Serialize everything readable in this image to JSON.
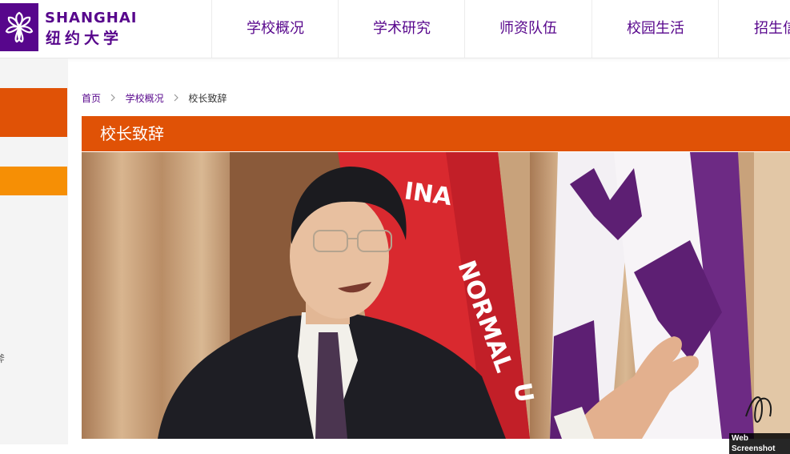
{
  "header": {
    "logo_en": "SHANGHAI",
    "logo_cn": "纽约大学",
    "nav": [
      "学校概况",
      "学术研究",
      "师资队伍",
      "校园生活",
      "招生信息"
    ]
  },
  "breadcrumb": {
    "home": "首页",
    "section": "学校概况",
    "current": "校长致辞"
  },
  "page": {
    "title": "校长致辞"
  },
  "sidebar": {
    "partial_text": "斧"
  },
  "photo": {
    "flag_letters": "INA NORMAL U"
  },
  "watermark": "Web Screenshot",
  "colors": {
    "brand_purple": "#57068c",
    "accent_orange": "#e05206",
    "accent_yellow": "#f68f05"
  }
}
